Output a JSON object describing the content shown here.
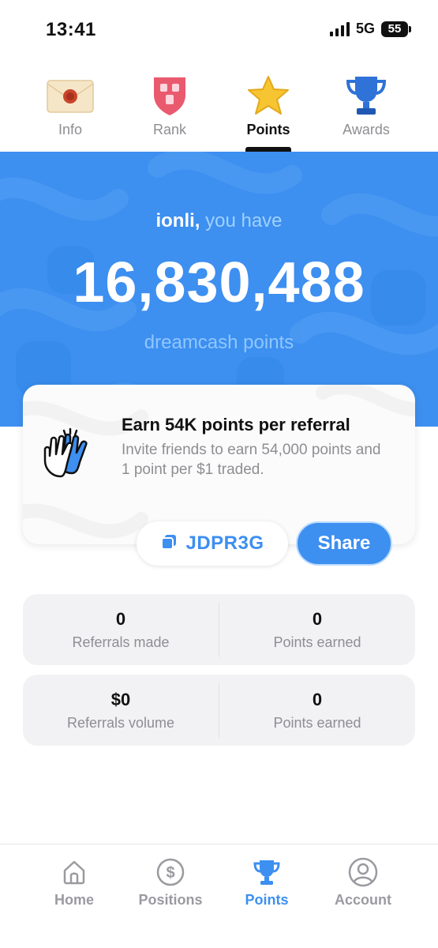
{
  "status_bar": {
    "time": "13:41",
    "network": "5G",
    "battery": "55"
  },
  "top_tabs": [
    {
      "label": "Info",
      "icon": "envelope-icon",
      "active": false
    },
    {
      "label": "Rank",
      "icon": "shield-icon",
      "active": false
    },
    {
      "label": "Points",
      "icon": "star-icon",
      "active": true
    },
    {
      "label": "Awards",
      "icon": "trophy-icon",
      "active": false
    }
  ],
  "hero": {
    "username": "ionli,",
    "greeting_suffix": "you have",
    "points": "16,830,488",
    "unit": "dreamcash points"
  },
  "referral": {
    "title": "Earn 54K points per referral",
    "description": "Invite friends to earn 54,000 points and 1 point per $1 traded.",
    "code": "JDPR3G",
    "share_label": "Share"
  },
  "stats": [
    {
      "value": "0",
      "label": "Referrals made"
    },
    {
      "value": "0",
      "label": "Points earned"
    },
    {
      "value": "$0",
      "label": "Referrals volume"
    },
    {
      "value": "0",
      "label": "Points earned"
    }
  ],
  "bottom_nav": [
    {
      "label": "Home",
      "icon": "home-icon",
      "active": false
    },
    {
      "label": "Positions",
      "icon": "dollar-circle-icon",
      "active": false
    },
    {
      "label": "Points",
      "icon": "trophy-icon",
      "active": true
    },
    {
      "label": "Account",
      "icon": "user-circle-icon",
      "active": false
    }
  ],
  "colors": {
    "accent": "#3d8ff0",
    "muted": "#8e8e93",
    "card_bg": "#f2f2f4"
  }
}
